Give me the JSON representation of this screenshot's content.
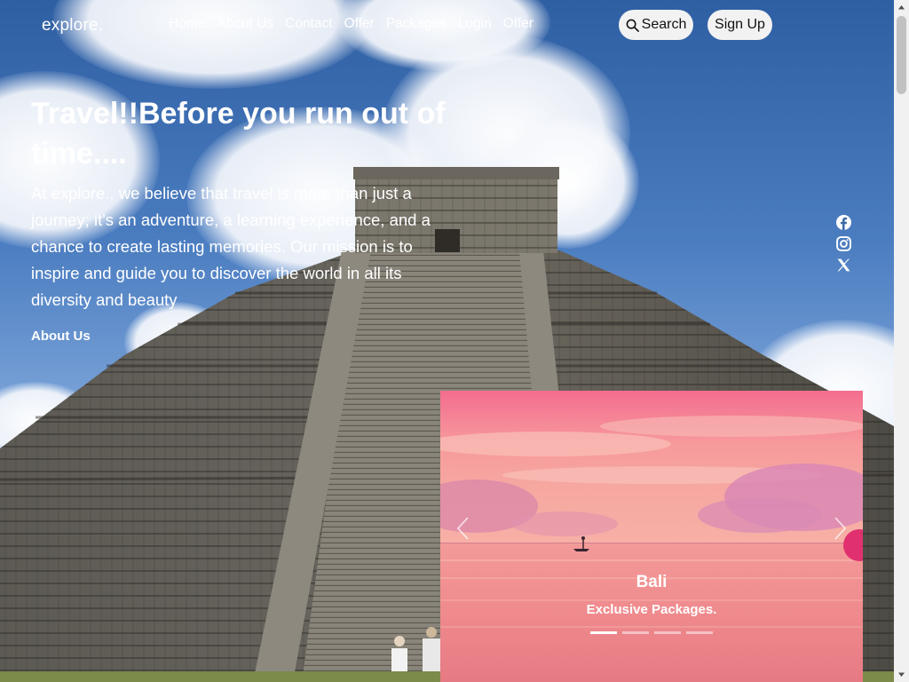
{
  "brand": {
    "logo": "explore."
  },
  "nav": {
    "links": [
      "Home",
      "About Us",
      "Contact",
      "Offer",
      "Packages",
      "Login",
      "Offer"
    ],
    "search_label": "Search",
    "signup_label": "Sign Up"
  },
  "hero": {
    "headline": "Travel!!Before you run out of time....",
    "tagline": "At explore., we believe that travel is more than just a journey; it's an adventure, a learning experience, and a chance to create lasting memories. Our mission is to inspire and guide you to discover the world in all its diversity and beauty",
    "link": "About Us"
  },
  "social": {
    "icons": [
      "facebook-icon",
      "instagram-icon",
      "x-twitter-icon"
    ]
  },
  "carousel": {
    "title": "Bali",
    "subtitle": "Exclusive Packages.",
    "indicator_count": 4,
    "active_index": 0
  },
  "colors": {
    "sky": "#4a7cc0",
    "pill_bg": "#f2f2f2",
    "sunset_pink": "#f08a9a",
    "stone": "#6e6a62"
  }
}
